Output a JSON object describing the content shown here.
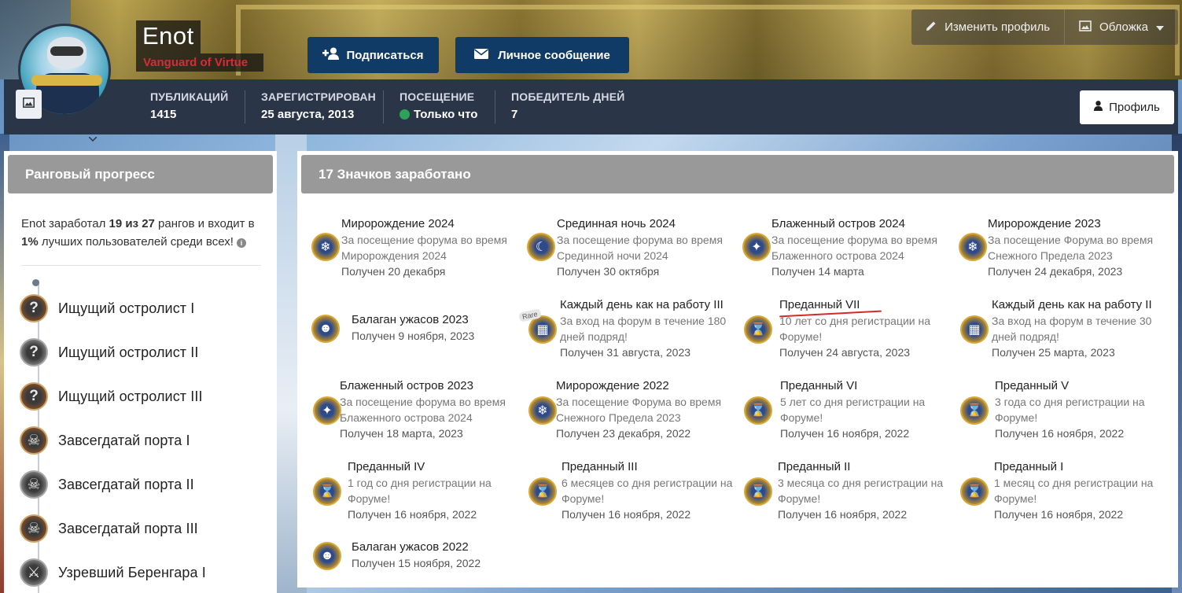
{
  "cover": {
    "edit_profile_label": "Изменить профиль",
    "cover_label": "Обложка"
  },
  "user": {
    "name": "Enot",
    "title": "Vanguard of Virtue"
  },
  "actions": {
    "follow_label": "Подписаться",
    "message_label": "Личное сообщение",
    "profile_label": "Профиль"
  },
  "stats": [
    {
      "label": "ПУБЛИКАЦИЙ",
      "value": "1415"
    },
    {
      "label": "ЗАРЕГИСТРИРОВАН",
      "value": "25 августа, 2013"
    },
    {
      "label": "ПОСЕЩЕНИЕ",
      "value": "Только что"
    },
    {
      "label": "ПОБЕДИТЕЛЬ ДНЕЙ",
      "value": "7"
    }
  ],
  "rank_panel": {
    "title": "Ранговый прогресс",
    "summary_prefix": "Enot заработал ",
    "summary_count": "19 из 27",
    "summary_mid": " рангов и входит в ",
    "summary_pct": "1%",
    "summary_suffix": " лучших пользователей среди всех!",
    "ranks": [
      {
        "label": "Ищущий остролист I",
        "icon": "question-rank-icon"
      },
      {
        "label": "Ищущий остролист II",
        "icon": "question-rank-icon"
      },
      {
        "label": "Ищущий остролист III",
        "icon": "question-rank-icon"
      },
      {
        "label": "Завсегдатай порта I",
        "icon": "skull-rank-icon"
      },
      {
        "label": "Завсегдатай порта II",
        "icon": "skull-rank-icon"
      },
      {
        "label": "Завсегдатай порта III",
        "icon": "skull-rank-icon"
      },
      {
        "label": "Узревший Беренгара I",
        "icon": "swords-rank-icon"
      }
    ]
  },
  "badges_panel": {
    "title": "17 Значков заработано",
    "rare_label": "Rare",
    "badges": [
      {
        "title": "Миророждение 2024",
        "desc1": "За посещение форума во время",
        "desc2": "Миророждения 2024",
        "date": "Получен 20 декабря"
      },
      {
        "title": "Срединная ночь 2024",
        "desc1": "За посещение форума во время",
        "desc2": "Срединной ночи 2024",
        "date": "Получен 30 октября"
      },
      {
        "title": "Блаженный остров 2024",
        "desc1": "За посещение форума во время",
        "desc2": "Блаженного острова 2024",
        "date": "Получен 14 марта"
      },
      {
        "title": "Миророждение 2023",
        "desc1": "За посещение Форума во время",
        "desc2": "Снежного Предела 2023",
        "date": "Получен 24 декабря, 2023"
      },
      {
        "title": "Балаган ужасов 2023",
        "desc1": "",
        "desc2": "",
        "date": "Получен 9 ноября, 2023"
      },
      {
        "title": "Каждый день как на работу III",
        "desc1": "За вход на форум в течение 180",
        "desc2": "дней подряд!",
        "date": "Получен 31 августа, 2023"
      },
      {
        "title": "Преданный VII",
        "desc1": "10 лет со дня регистрации на",
        "desc2": "Форуме!",
        "date": "Получен 24 августа, 2023"
      },
      {
        "title": "Каждый день как на работу II",
        "desc1": "За вход на форум в течение 30",
        "desc2": "дней подряд!",
        "date": "Получен 25 марта, 2023"
      },
      {
        "title": "Блаженный остров 2023",
        "desc1": "За посещение форума во время",
        "desc2": "Блаженного острова 2024",
        "date": "Получен 18 марта, 2023"
      },
      {
        "title": "Миророждение 2022",
        "desc1": "За посещение Форума во время",
        "desc2": "Снежного Предела 2023",
        "date": "Получен 23 декабря, 2022"
      },
      {
        "title": "Преданный VI",
        "desc1": "5 лет со дня регистрации на",
        "desc2": "Форуме!",
        "date": "Получен 16 ноября, 2022"
      },
      {
        "title": "Преданный V",
        "desc1": "3 года со дня регистрации на",
        "desc2": "Форуме!",
        "date": "Получен 16 ноября, 2022"
      },
      {
        "title": "Преданный IV",
        "desc1": "1 год со дня регистрации на",
        "desc2": "Форуме!",
        "date": "Получен 16 ноября, 2022"
      },
      {
        "title": "Преданный III",
        "desc1": "6 месяцев со дня регистрации на",
        "desc2": "Форуме!",
        "date": "Получен 16 ноября, 2022"
      },
      {
        "title": "Преданный II",
        "desc1": "3 месяца со дня регистрации на",
        "desc2": "Форуме!",
        "date": "Получен 16 ноября, 2022"
      },
      {
        "title": "Преданный I",
        "desc1": "1 месяц со дня регистрации на",
        "desc2": "Форуме!",
        "date": "Получен 16 ноября, 2022"
      },
      {
        "title": "Балаган ужасов 2022",
        "desc1": "",
        "desc2": "",
        "date": "Получен 15 ноября, 2022"
      }
    ]
  },
  "colors": {
    "stats_bar": "#2b3548",
    "primary_button": "#0f3b66",
    "panel_header": "#999999",
    "online": "#2fa25a",
    "user_title": "#d92a3a"
  }
}
